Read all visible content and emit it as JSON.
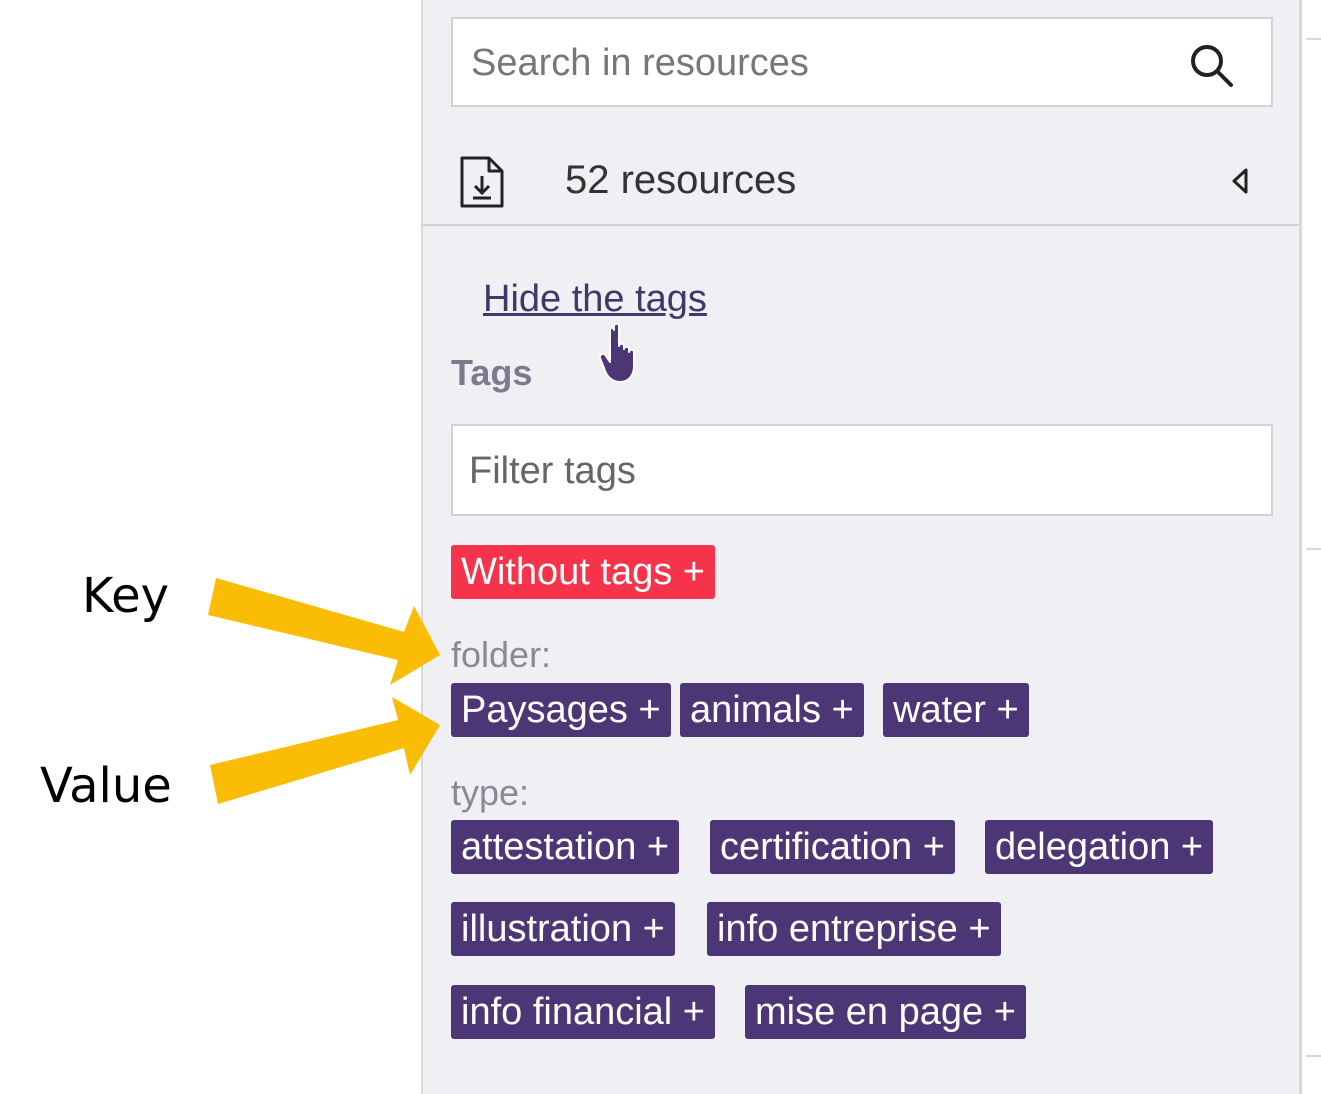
{
  "annotations": {
    "key_label": "Key",
    "value_label": "Value",
    "arrow_color": "#fbbc05"
  },
  "sidebar": {
    "search": {
      "placeholder": "Search in resources",
      "value": "",
      "icon": "search-icon"
    },
    "resources": {
      "count_text": "52 resources",
      "download_icon": "document-download-icon",
      "collapse_icon": "caret-left-icon"
    },
    "hide_tags_link": "Hide the tags",
    "tags_heading": "Tags",
    "filter": {
      "placeholder": "Filter tags",
      "value": ""
    },
    "without_tags": "Without tags +",
    "groups": [
      {
        "key": "folder:",
        "values": [
          "Paysages +",
          "animals +",
          "water +"
        ]
      },
      {
        "key": "type:",
        "values": [
          "attestation +",
          "certification +",
          "delegation +",
          "illustration +",
          "info entreprise +",
          "info financial +",
          "mise en page +"
        ]
      }
    ]
  },
  "colors": {
    "accent_purple": "#4c3676",
    "alert_red": "#f5334a",
    "panel_bg": "#f0eff4",
    "link": "#3d3a6b"
  }
}
